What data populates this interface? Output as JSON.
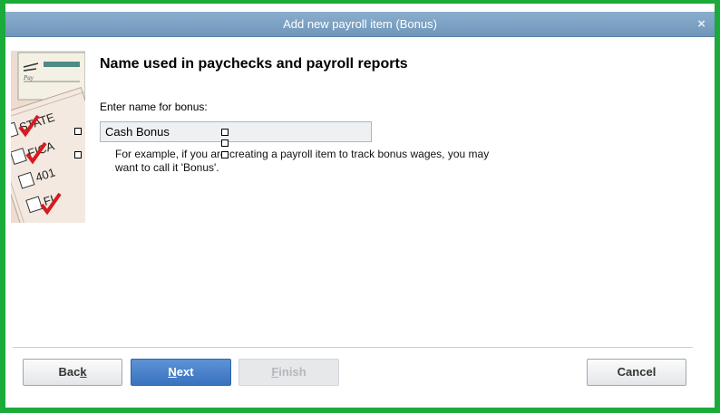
{
  "window": {
    "title": "Add new payroll item (Bonus)",
    "close_glyph": "×"
  },
  "illustration": {
    "labels": [
      "STATE",
      "FICA",
      "401",
      "FI",
      "Pay"
    ]
  },
  "content": {
    "heading": "Name used in paychecks and payroll reports",
    "field_label": "Enter name for bonus:",
    "field_value": "Cash Bonus",
    "hint_line1": "For example, if you are creating a payroll item to track bonus wages, you may",
    "hint_line2": "want to call it 'Bonus'."
  },
  "buttons": {
    "back": {
      "prefix": "Bac",
      "mnemonic": "k",
      "suffix": ""
    },
    "next": {
      "prefix": "",
      "mnemonic": "N",
      "suffix": "ext"
    },
    "finish": {
      "prefix": "",
      "mnemonic": "F",
      "suffix": "inish"
    },
    "cancel": "Cancel"
  },
  "colors": {
    "frame_border": "#1aab3a",
    "titlebar": "#7ea3c6",
    "next_button": "#3f7ac6",
    "illustration_bg": "#e9d6c7",
    "check_red": "#d71920"
  }
}
